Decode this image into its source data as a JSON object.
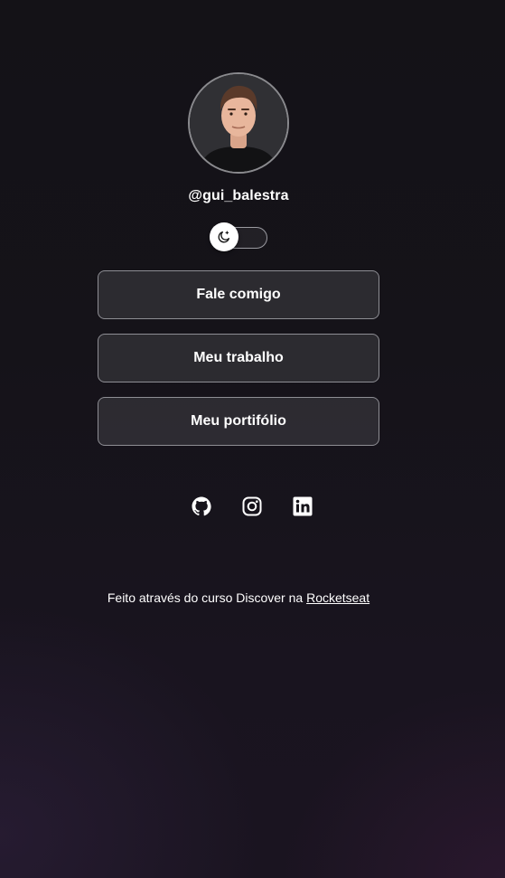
{
  "profile": {
    "username": "@gui_balestra",
    "avatar_alt": "gui_balestra avatar"
  },
  "theme_switch": {
    "icon": "moon-icon"
  },
  "links": [
    {
      "label": "Fale comigo"
    },
    {
      "label": "Meu trabalho"
    },
    {
      "label": "Meu portifólio"
    }
  ],
  "social": [
    {
      "icon": "github-icon"
    },
    {
      "icon": "instagram-icon"
    },
    {
      "icon": "linkedin-icon"
    }
  ],
  "footer": {
    "text": "Feito através do curso Discover na ",
    "link_label": "Rocketseat"
  },
  "colors": {
    "background": "#151319",
    "text": "#ffffff",
    "button_border": "#8e8e94"
  }
}
